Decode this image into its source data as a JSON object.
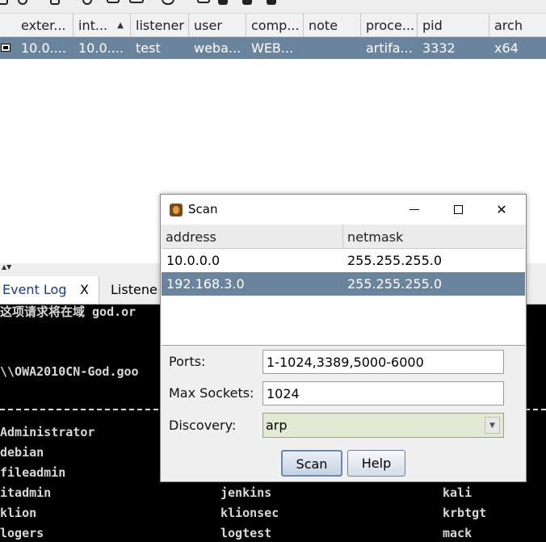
{
  "beacon_table": {
    "columns": [
      {
        "label": "exter..."
      },
      {
        "label": "int...",
        "sort": "ascending"
      },
      {
        "label": "listener"
      },
      {
        "label": "user"
      },
      {
        "label": "comp..."
      },
      {
        "label": "note"
      },
      {
        "label": "proce..."
      },
      {
        "label": "pid"
      },
      {
        "label": "arch"
      }
    ],
    "rows": [
      {
        "external": "10.0....",
        "internal": "10.0....",
        "listener": "test",
        "user": "weba...",
        "computer": "WEB...",
        "note": "",
        "process": "artifa...",
        "pid": "3332",
        "arch": "x64"
      }
    ]
  },
  "tabs": [
    {
      "label": "Event Log",
      "close": "X",
      "active": true
    },
    {
      "label": "Listene",
      "active": false
    }
  ],
  "console": {
    "lines": [
      "这项请求将在域 god.or",
      "\\\\OWA2010CN-God.goo",
      "Administrator",
      "debian",
      "fileadmin"
    ],
    "users_grid": [
      [
        "itadmin",
        "jenkins",
        "kali"
      ],
      [
        "klion",
        "klionsec",
        "krbtgt"
      ],
      [
        "logers",
        "logtest",
        "mack"
      ]
    ]
  },
  "dialog": {
    "title": "Scan",
    "window_controls": {
      "close": "✕"
    },
    "network_table": {
      "columns": [
        "address",
        "netmask"
      ],
      "rows": [
        {
          "address": "10.0.0.0",
          "netmask": "255.255.255.0",
          "selected": false
        },
        {
          "address": "192.168.3.0",
          "netmask": "255.255.255.0",
          "selected": true
        }
      ]
    },
    "form": {
      "ports_label": "Ports:",
      "ports_value": "1-1024,3389,5000-6000",
      "max_sockets_label": "Max Sockets:",
      "max_sockets_value": "1024",
      "discovery_label": "Discovery:",
      "discovery_value": "arp"
    },
    "buttons": {
      "scan": "Scan",
      "help": "Help"
    }
  },
  "colors": {
    "selection": "#6b849e",
    "console_bg": "#000000",
    "console_text": "#d8d8d8",
    "select_bg": "#e3ead2"
  }
}
